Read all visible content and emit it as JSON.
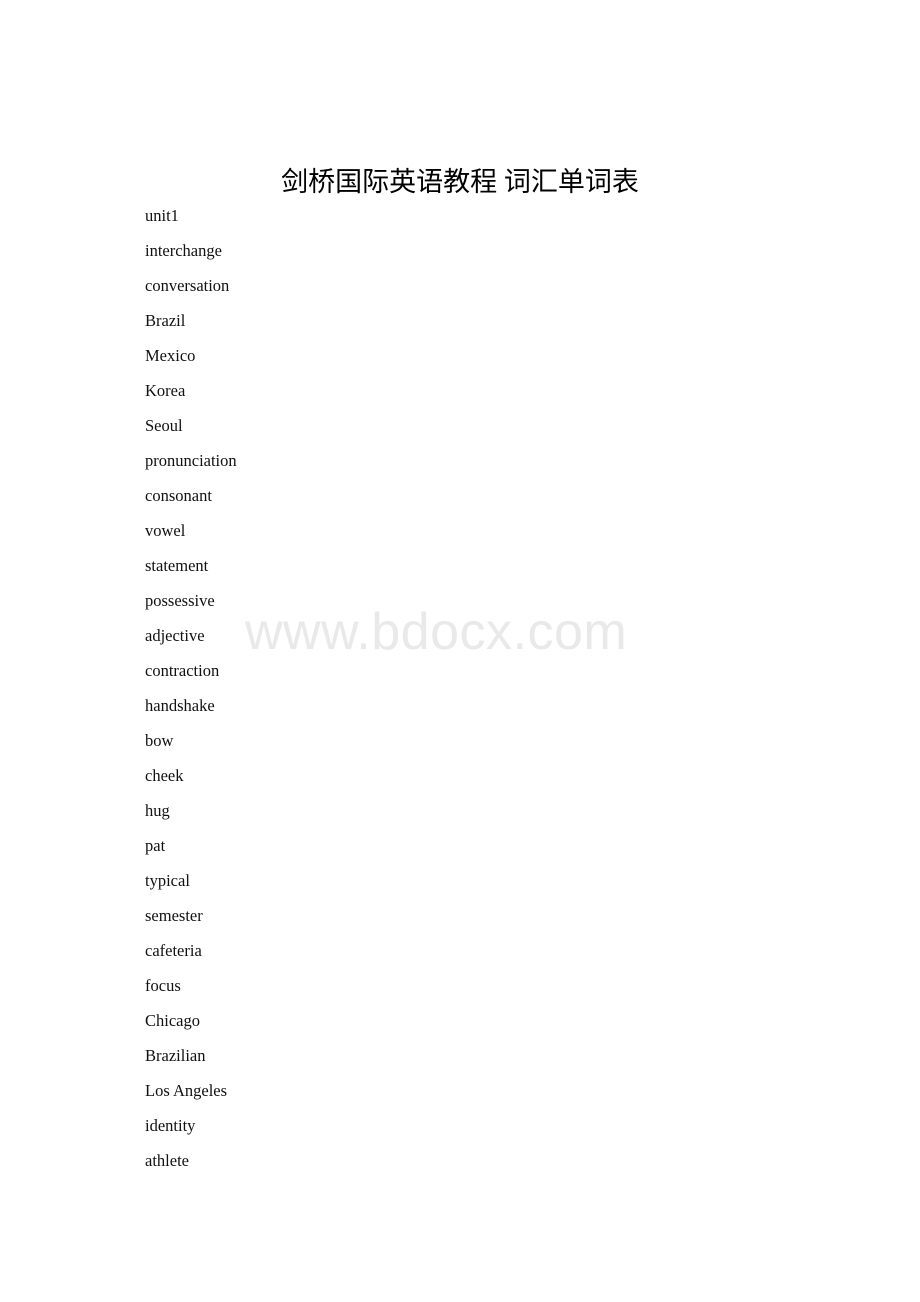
{
  "document": {
    "title": "剑桥国际英语教程 词汇单词表",
    "watermark": "www.bdocx.com",
    "watermark_color": "#e9e9e9",
    "text_color": "#111111",
    "page_background": "#ffffff",
    "words": [
      "unit1",
      "interchange",
      "conversation",
      "Brazil",
      "Mexico",
      "Korea",
      "Seoul",
      "pronunciation",
      "consonant",
      "vowel",
      "statement",
      "possessive",
      "adjective",
      "contraction",
      "handshake",
      "bow",
      "cheek",
      "hug",
      "pat",
      "typical",
      "semester",
      "cafeteria",
      "focus",
      "Chicago",
      "Brazilian",
      "Los Angeles",
      "identity",
      "athlete"
    ]
  }
}
